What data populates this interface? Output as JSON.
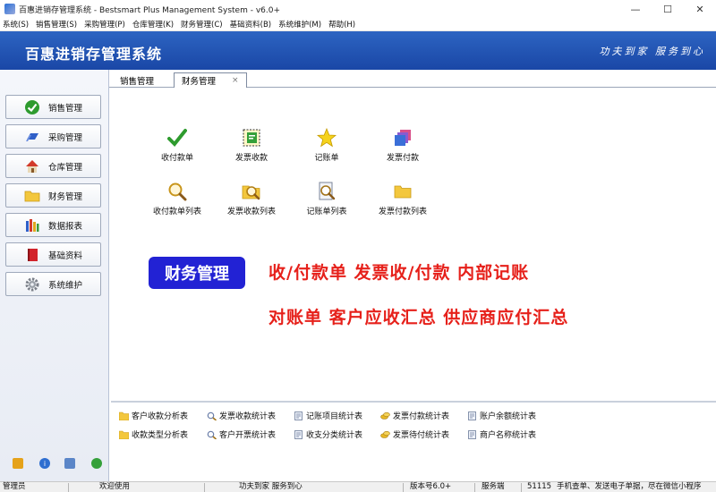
{
  "window": {
    "title": "百惠进销存管理系统 - Bestsmart Plus Management System - v6.0+",
    "minimize": "—",
    "maximize": "☐",
    "close": "✕"
  },
  "menu": [
    "系统(S)",
    "销售管理(S)",
    "采购管理(P)",
    "仓库管理(K)",
    "财务管理(C)",
    "基础资料(B)",
    "系统维护(M)",
    "帮助(H)"
  ],
  "banner": {
    "brand": "百惠进销存管理系统",
    "slogan": "功夫到家 服务到心"
  },
  "sidebar": [
    {
      "label": "销售管理",
      "icon": "check-icon"
    },
    {
      "label": "采购管理",
      "icon": "purchase-icon"
    },
    {
      "label": "仓库管理",
      "icon": "house-icon"
    },
    {
      "label": "财务管理",
      "icon": "folder-icon"
    },
    {
      "label": "数据报表",
      "icon": "books-icon"
    },
    {
      "label": "基础资料",
      "icon": "book-icon"
    },
    {
      "label": "系统维护",
      "icon": "gear-icon"
    }
  ],
  "tabs": [
    {
      "label": "销售管理",
      "active": false
    },
    {
      "label": "财务管理",
      "active": true,
      "close": "×"
    }
  ],
  "functions": [
    {
      "label": "收付款单",
      "icon": "check-icon"
    },
    {
      "label": "发票收款",
      "icon": "invoice-icon"
    },
    {
      "label": "记账单",
      "icon": "star-icon"
    },
    {
      "label": "发票付款",
      "icon": "stack-icon"
    },
    {
      "label": "收付款单列表",
      "icon": "magnifier-icon"
    },
    {
      "label": "发票收款列表",
      "icon": "folder-search-icon"
    },
    {
      "label": "记账单列表",
      "icon": "doc-search-icon"
    },
    {
      "label": "发票付款列表",
      "icon": "folder-icon"
    }
  ],
  "promo": {
    "badge": "财务管理",
    "line1": "收/付款单  发票收/付款  内部记账",
    "line2": "对账单  客户应收汇总  供应商应付汇总"
  },
  "reports": [
    {
      "label": "客户收款分析表",
      "icon": "folder-icon"
    },
    {
      "label": "发票收款统计表",
      "icon": "magnifier-icon"
    },
    {
      "label": "记账项目统计表",
      "icon": "doc-icon"
    },
    {
      "label": "发票付款统计表",
      "icon": "coins-icon"
    },
    {
      "label": "账户余额统计表",
      "icon": "doc-icon"
    },
    {
      "label": "收款类型分析表",
      "icon": "folder-icon"
    },
    {
      "label": "客户开票统计表",
      "icon": "magnifier-icon"
    },
    {
      "label": "收支分类统计表",
      "icon": "doc-icon"
    },
    {
      "label": "发票待付统计表",
      "icon": "coins-icon"
    },
    {
      "label": "商户名称统计表",
      "icon": "doc-icon"
    }
  ],
  "status": {
    "user": "管理员",
    "welcome": "欢迎使用",
    "motto": "功夫到家 服务到心",
    "version": "版本号6.0+",
    "mode": "服务端",
    "code": "51115",
    "tip": "手机查单、发送电子单据，尽在微信小程序"
  }
}
